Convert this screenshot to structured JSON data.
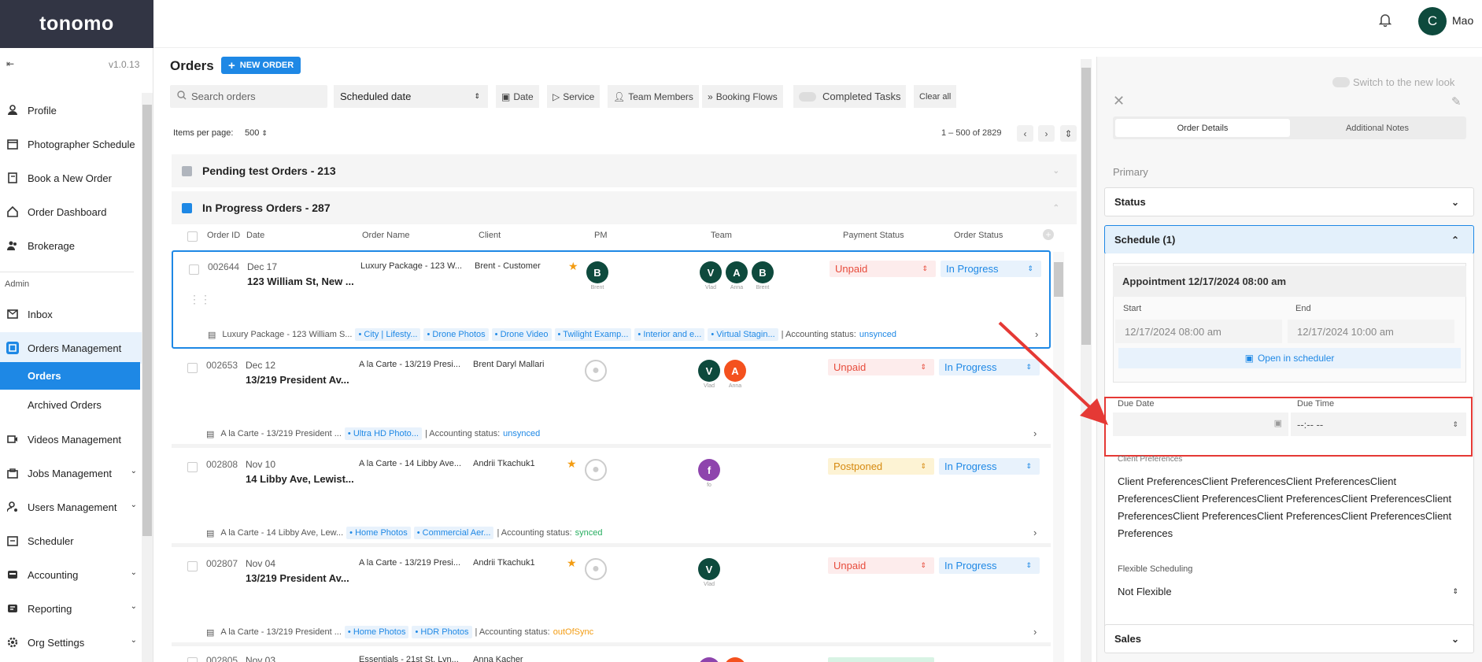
{
  "app": {
    "logo": "tonomo",
    "version": "v1.0.13",
    "collapse_icon": "collapse-icon"
  },
  "topbar": {
    "avatar_letter": "C",
    "user_name": "Mao",
    "bell_icon": "bell-icon"
  },
  "sidebar": {
    "items": [
      {
        "label": "Profile",
        "icon": "person-icon"
      },
      {
        "label": "Photographer Schedule",
        "icon": "calendar-icon"
      },
      {
        "label": "Book a New Order",
        "icon": "book-icon"
      },
      {
        "label": "Order Dashboard",
        "icon": "home-icon"
      },
      {
        "label": "Brokerage",
        "icon": "group-icon"
      }
    ],
    "admin_label": "Admin",
    "admin_items": [
      {
        "label": "Inbox",
        "icon": "mail-icon"
      },
      {
        "label": "Orders Management",
        "icon": "orders-icon"
      },
      {
        "label": "Orders",
        "icon": ""
      },
      {
        "label": "Archived Orders",
        "icon": ""
      },
      {
        "label": "Videos Management",
        "icon": "video-icon"
      },
      {
        "label": "Jobs Management",
        "icon": "jobs-icon"
      },
      {
        "label": "Users Management",
        "icon": "users-icon"
      },
      {
        "label": "Scheduler",
        "icon": "scheduler-icon"
      },
      {
        "label": "Accounting",
        "icon": "accounting-icon"
      },
      {
        "label": "Reporting",
        "icon": "reporting-icon"
      },
      {
        "label": "Org Settings",
        "icon": "settings-icon"
      }
    ]
  },
  "orders": {
    "title": "Orders",
    "new_order": "NEW ORDER",
    "search_placeholder": "Search orders",
    "date_select": "Scheduled date",
    "filters": [
      "Date",
      "Service",
      "Team Members",
      "Booking Flows",
      "Completed Tasks",
      "Clear all"
    ],
    "items_per_page_label": "Items per page:",
    "items_per_page": "500",
    "range": "1 – 500 of 2829",
    "groups": [
      {
        "label": "Pending test Orders - 213",
        "color": "#b0b5bd"
      },
      {
        "label": "In Progress Orders - 287",
        "color": "#1e88e5"
      }
    ],
    "columns": [
      "Order ID",
      "Date",
      "Order Name",
      "Client",
      "PM",
      "Team",
      "Payment Status",
      "Order Status"
    ],
    "rows": [
      {
        "id": "002644",
        "date": "Dec 17",
        "address": "123 William St, New ...",
        "name": "Luxury Package - 123 W...",
        "client": "Brent - Customer",
        "star": true,
        "pm": {
          "letter": "B",
          "label": "Brent",
          "color": "#0e4a3d"
        },
        "team": [
          {
            "letter": "V",
            "label": "Vlad",
            "color": "#0e4a3d"
          },
          {
            "letter": "A",
            "label": "Anna",
            "color": "#0e4a3d"
          },
          {
            "letter": "B",
            "label": "Brent",
            "color": "#0e4a3d"
          }
        ],
        "payment": "Unpaid",
        "status": "In Progress",
        "foot_name": "Luxury Package - 123 William S...",
        "tags": [
          "City | Lifesty...",
          "Drone Photos",
          "Drone Video",
          "Twilight Examp...",
          "Interior and e...",
          "Virtual Stagin..."
        ],
        "acct_label": "| Accounting status:",
        "acct": "unsynced"
      },
      {
        "id": "002653",
        "date": "Dec 12",
        "address": "13/219 President Av...",
        "name": "A la Carte - 13/219 Presi...",
        "client": "Brent Daryl Mallari",
        "star": false,
        "pm": null,
        "team": [
          {
            "letter": "V",
            "label": "Vlad",
            "color": "#0e4a3d"
          },
          {
            "letter": "A",
            "label": "Anna",
            "color": "#f4511e"
          }
        ],
        "payment": "Unpaid",
        "status": "In Progress",
        "foot_name": "A la Carte - 13/219 President ...",
        "tags": [
          "Ultra HD Photo..."
        ],
        "acct_label": "| Accounting status:",
        "acct": "unsynced"
      },
      {
        "id": "002808",
        "date": "Nov 10",
        "address": "14 Libby Ave, Lewist...",
        "name": "A la Carte - 14 Libby Ave...",
        "client": "Andrii Tkachuk1",
        "star": true,
        "pm": null,
        "team": [
          {
            "letter": "f",
            "label": "fo",
            "color": "#8e44ad"
          }
        ],
        "payment": "Postponed",
        "status": "In Progress",
        "foot_name": "A la Carte - 14 Libby Ave, Lew...",
        "tags": [
          "Home Photos",
          "Commercial Aer..."
        ],
        "acct_label": "| Accounting status:",
        "acct": "synced"
      },
      {
        "id": "002807",
        "date": "Nov 04",
        "address": "13/219 President Av...",
        "name": "A la Carte - 13/219 Presi...",
        "client": "Andrii Tkachuk1",
        "star": true,
        "pm": null,
        "team": [
          {
            "letter": "V",
            "label": "Vlad",
            "color": "#0e4a3d"
          }
        ],
        "payment": "Unpaid",
        "status": "In Progress",
        "foot_name": "A la Carte - 13/219 President ...",
        "tags": [
          "Home Photos",
          "HDR Photos"
        ],
        "acct_label": "| Accounting status:",
        "acct": "outOfSync"
      },
      {
        "id": "002805",
        "date": "Nov 03",
        "address": "",
        "name": "Essentials - 21st St, Lyn...",
        "client": "Anna Kacher",
        "star": false,
        "pm": null,
        "team": [],
        "payment": "",
        "status": "",
        "foot_name": "",
        "tags": [],
        "acct_label": "",
        "acct": ""
      }
    ]
  },
  "panel": {
    "switch_label": "Switch to the new look",
    "tabs": [
      "Order Details",
      "Additional Notes"
    ],
    "primary": "Primary",
    "status_title": "Status",
    "schedule_title": "Schedule (1)",
    "appointment_title": "Appointment 12/17/2024 08:00 am",
    "start_label": "Start",
    "end_label": "End",
    "start_value": "12/17/2024 08:00 am",
    "end_value": "12/17/2024 10:00 am",
    "open_scheduler": "Open in scheduler",
    "due_date_label": "Due Date",
    "due_time_label": "Due Time",
    "due_time_value": "--:-- --",
    "client_pref_label": "Client Preferences",
    "client_pref_text": "Client PreferencesClient PreferencesClient PreferencesClient PreferencesClient PreferencesClient PreferencesClient PreferencesClient PreferencesClient PreferencesClient PreferencesClient PreferencesClient Preferences",
    "flex_label": "Flexible Scheduling",
    "flex_value": "Not Flexible",
    "sales_title": "Sales"
  },
  "colors": {
    "accent": "#1e88e5",
    "sidebar_dark": "#323544",
    "avatar_green": "#0e4a3d",
    "highlight_red": "#e53935"
  }
}
